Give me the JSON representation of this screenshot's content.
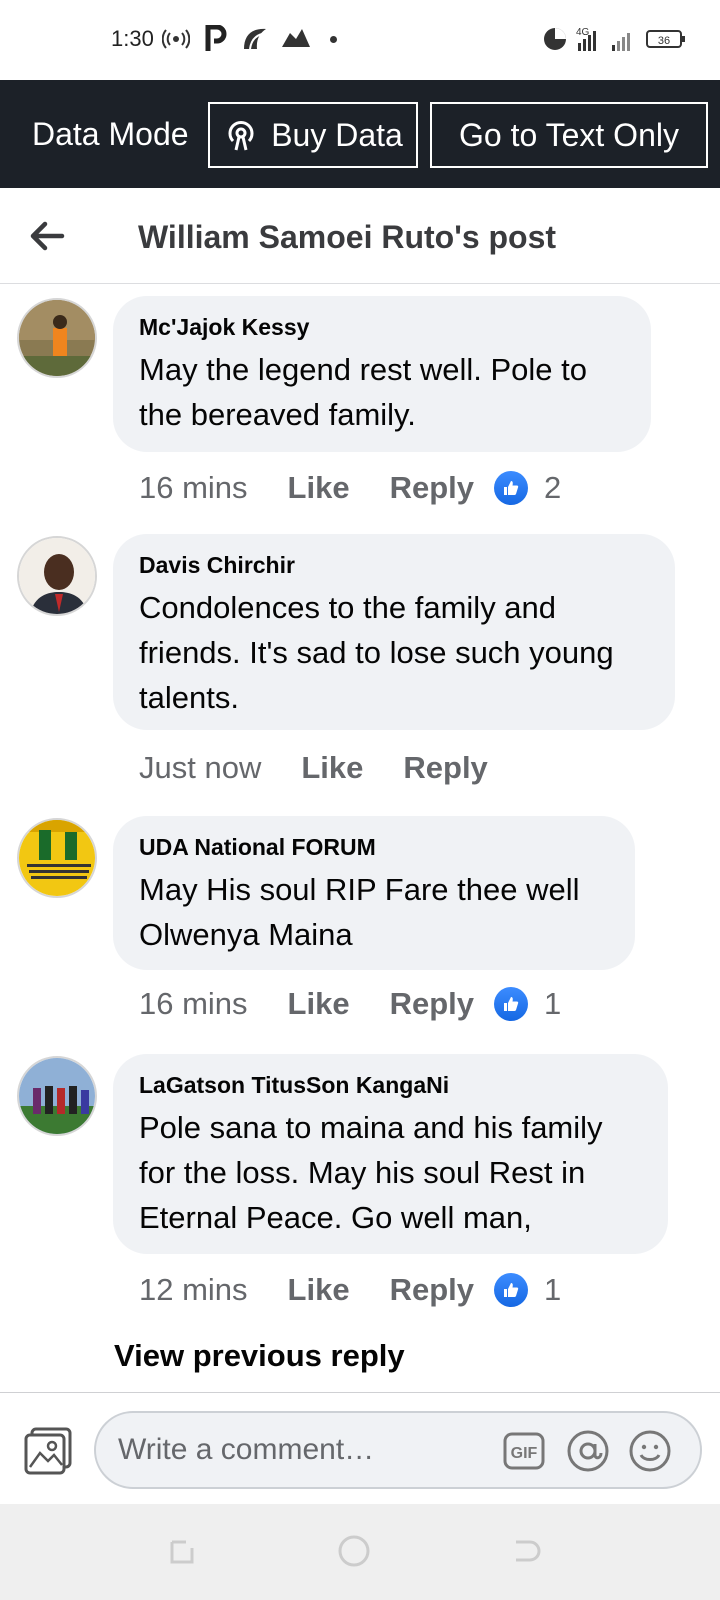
{
  "status_bar": {
    "time": "1:30",
    "network": "4G",
    "battery": "36"
  },
  "data_bar": {
    "mode_label": "Data Mode",
    "buy_label": "Buy Data",
    "text_only_label": "Go to Text Only"
  },
  "header": {
    "title": "William Samoei Ruto's post"
  },
  "comments": [
    {
      "author": "Mc'Jajok Kessy",
      "text": "May the legend rest well. Pole to the bereaved family.",
      "time": "16 mins",
      "like": "Like",
      "reply": "Reply",
      "likes": "2"
    },
    {
      "author": "Davis Chirchir",
      "text": "Condolences to the family and friends. It's sad to lose such young talents.",
      "time": "Just now",
      "like": "Like",
      "reply": "Reply",
      "likes": ""
    },
    {
      "author": "UDA National FORUM",
      "text": "May His soul RIP Fare thee well Olwenya Maina",
      "time": "16 mins",
      "like": "Like",
      "reply": "Reply",
      "likes": "1"
    },
    {
      "author": "LaGatson TitusSon KangaNi",
      "text": "Pole sana to maina and his family for the loss. May his soul Rest in Eternal Peace. Go well man,",
      "time": "12 mins",
      "like": "Like",
      "reply": "Reply",
      "likes": "1"
    }
  ],
  "view_previous": "View previous reply",
  "composer": {
    "placeholder": "Write a comment…",
    "gif_label": "GIF"
  },
  "colors": {
    "data_bar_bg": "#1c2128",
    "bubble_bg": "#f0f2f5",
    "like_blue": "#1877f2",
    "meta_gray": "#65676b"
  }
}
